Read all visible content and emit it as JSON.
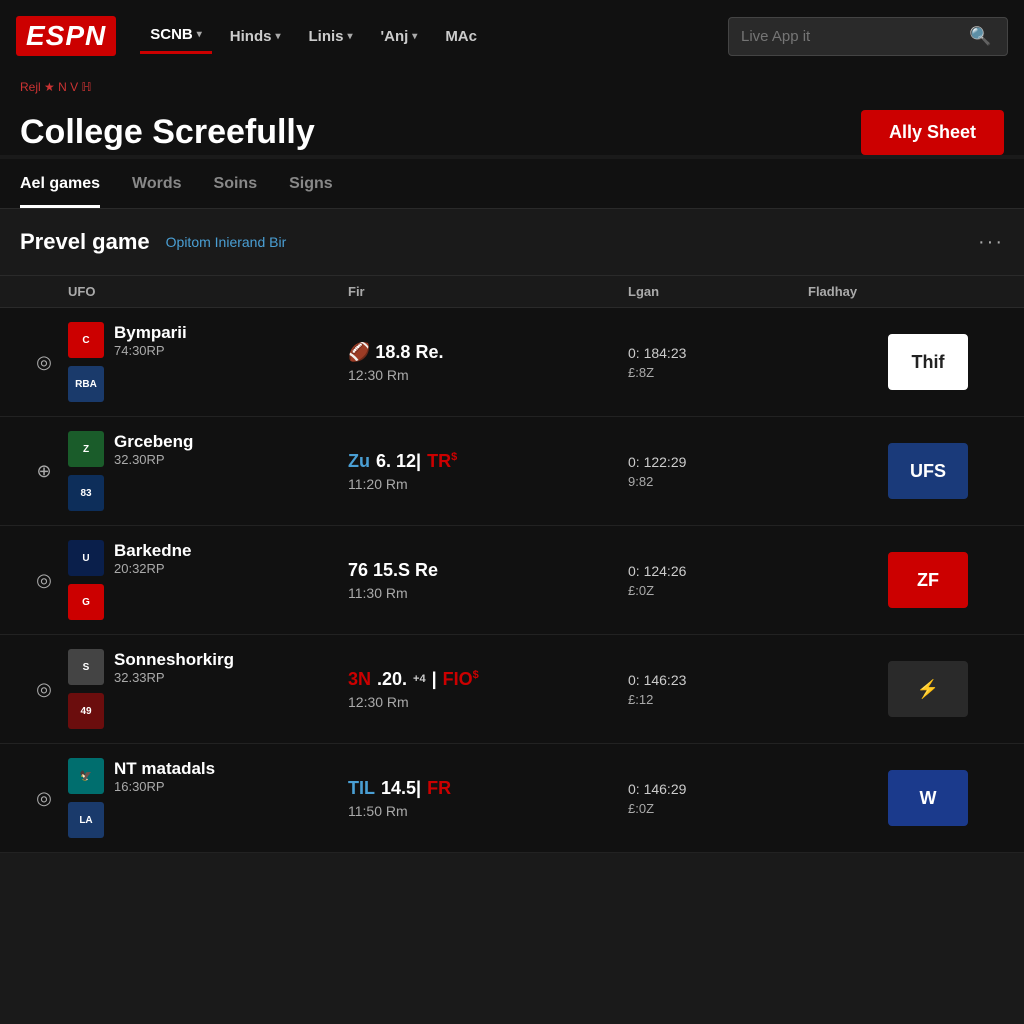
{
  "navbar": {
    "logo": "ESPN",
    "nav_items": [
      {
        "label": "SCNB",
        "has_dropdown": true,
        "active": true
      },
      {
        "label": "Hinds",
        "has_dropdown": true
      },
      {
        "label": "Linis",
        "has_dropdown": true
      },
      {
        "label": "'Anj",
        "has_dropdown": true
      },
      {
        "label": "MAc",
        "has_dropdown": false
      }
    ],
    "search_placeholder": "Live App it"
  },
  "breadcrumb": {
    "text": "Rejl ★ N V ℍ"
  },
  "page": {
    "title": "College Screefully",
    "ally_button": "Ally Sheet"
  },
  "tabs": [
    {
      "label": "Ael games",
      "active": true
    },
    {
      "label": "Words",
      "active": false
    },
    {
      "label": "Soins",
      "active": false
    },
    {
      "label": "Signs",
      "active": false
    }
  ],
  "section": {
    "title": "Prevel game",
    "subtitle": "Opitom Inierand Bir",
    "more": "···"
  },
  "table": {
    "headers": [
      "",
      "UFO",
      "Fir",
      "Lgan",
      "Fladhay"
    ],
    "games": [
      {
        "icon": "◎",
        "teams": [
          {
            "name": "Bymparii",
            "record": "74:30RP",
            "logo_class": "logo-red",
            "logo_text": "C"
          },
          {
            "name": "",
            "record": "",
            "logo_class": "logo-blue",
            "logo_text": "RBA"
          }
        ],
        "fir_top": "🏈 18.8 Re.",
        "fir_time": "12:30 Rm",
        "lgan_top": "0: 184:23",
        "lgan_bottom": "£:8Z",
        "sponsor_class": "sponsor-white",
        "sponsor_text": "Thif"
      },
      {
        "icon": "⊕",
        "teams": [
          {
            "name": "Grcebeng",
            "record": "32.30RP",
            "logo_class": "logo-green",
            "logo_text": "Z"
          },
          {
            "name": "",
            "record": "",
            "logo_class": "logo-darkblue",
            "logo_text": "83"
          }
        ],
        "fir_top": "Zu 6. 12|TR$",
        "fir_time": "11:20 Rm",
        "lgan_top": "0: 122:29",
        "lgan_bottom": "9:82",
        "sponsor_class": "sponsor-blue2",
        "sponsor_text": "UFS"
      },
      {
        "icon": "◎",
        "teams": [
          {
            "name": "Barkedne",
            "record": "20:32RP",
            "logo_class": "logo-navy",
            "logo_text": "U"
          },
          {
            "name": "",
            "record": "",
            "logo_class": "logo-red",
            "logo_text": "G"
          }
        ],
        "fir_top": "76 15.S Re",
        "fir_time": "11:30 Rm",
        "lgan_top": "0: 124:26",
        "lgan_bottom": "£:0Z",
        "sponsor_class": "sponsor-red2",
        "sponsor_text": "ZF"
      },
      {
        "icon": "◎",
        "teams": [
          {
            "name": "Sonneshorkirg",
            "record": "32.33RP",
            "logo_class": "logo-gray",
            "logo_text": "S"
          },
          {
            "name": "",
            "record": "",
            "logo_class": "logo-maroon",
            "logo_text": "49"
          }
        ],
        "fir_top": "3N.20.+4|FIO$",
        "fir_time": "12:30 Rm",
        "lgan_top": "0: 146:23",
        "lgan_bottom": "£:12",
        "sponsor_class": "sponsor-gold",
        "sponsor_text": "⚡"
      },
      {
        "icon": "◎",
        "teams": [
          {
            "name": "NT matadals",
            "record": "16:30RP",
            "logo_class": "logo-teal",
            "logo_text": "🦅"
          },
          {
            "name": "",
            "record": "",
            "logo_class": "logo-blue",
            "logo_text": "LA"
          }
        ],
        "fir_top": "TIL 14.5|FR",
        "fir_time": "11:50 Rm",
        "lgan_top": "0: 146:29",
        "lgan_bottom": "£:0Z",
        "sponsor_class": "sponsor-cubsblue",
        "sponsor_text": "W"
      }
    ]
  }
}
